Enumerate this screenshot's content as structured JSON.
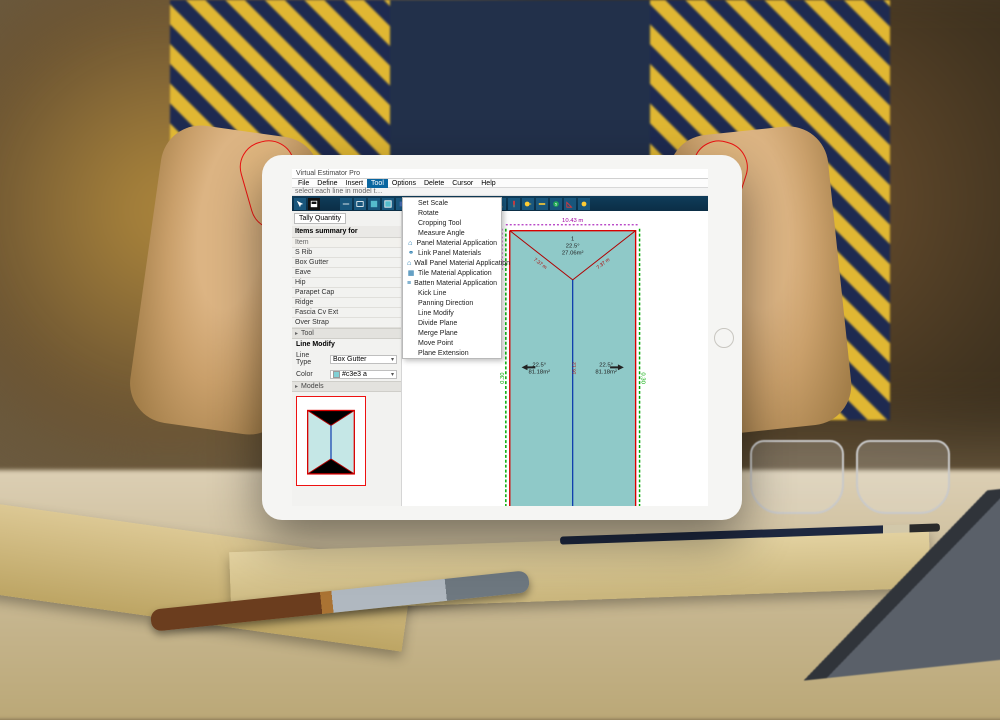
{
  "app_title": "Virtual Estimator Pro",
  "menu": [
    "File",
    "Define",
    "Insert",
    "Tool",
    "Options",
    "Delete",
    "Cursor",
    "Help"
  ],
  "menu_active_index": 3,
  "helper_text": "select each line in model t…",
  "toolbar_icons": [
    "select",
    "save",
    "undo",
    "redo",
    "hline",
    "rect",
    "panel",
    "fill",
    "square1",
    "square2",
    "square3",
    "knife",
    "wrench",
    "gear",
    "paint",
    "hammer",
    "hammer2",
    "tape",
    "ruler",
    "circle5",
    "angle",
    "tape2"
  ],
  "left": {
    "tab_label": "Tally Quantity",
    "items_header": "Items summary for",
    "items_col": "Item",
    "items": [
      "S Rib",
      "Box Gutter",
      "Eave",
      "Hip",
      "Parapet Cap",
      "Ridge",
      "Fascia Cv Ext",
      "Over Strap"
    ],
    "tool_section": "Tool",
    "linemodify_title": "Line Modify",
    "linetype_label": "Line Type",
    "linetype_value": "Box Gutter",
    "color_label": "Color",
    "color_value": "#c3e3 a",
    "models_section": "Models"
  },
  "dropdown": {
    "items": [
      {
        "label": "Set Scale",
        "icon": ""
      },
      {
        "label": "Rotate",
        "icon": ""
      },
      {
        "label": "Cropping Tool",
        "icon": ""
      },
      {
        "label": "Measure Angle",
        "icon": ""
      },
      {
        "label": "Panel Material Application",
        "icon": "home"
      },
      {
        "label": "Link Panel Materials",
        "icon": "link"
      },
      {
        "label": "Wall Panel Material Application",
        "icon": "home"
      },
      {
        "label": "Tile Material Application",
        "icon": "tile"
      },
      {
        "label": "Batten Material Application",
        "icon": "batten"
      },
      {
        "label": "Kick Line",
        "icon": ""
      },
      {
        "label": "Panning Direction",
        "icon": ""
      },
      {
        "label": "Line Modify",
        "icon": ""
      },
      {
        "label": "Divide Plane",
        "icon": ""
      },
      {
        "label": "Merge Plane",
        "icon": ""
      },
      {
        "label": "Move Point",
        "icon": ""
      },
      {
        "label": "Plane Extension",
        "icon": ""
      }
    ]
  },
  "plan": {
    "top_width": "10.43 m",
    "panel_top": {
      "id": "1",
      "angle": "22.5°",
      "area": "27.06m²"
    },
    "panel_side": {
      "angle": "22.5°",
      "area": "81.18m²"
    },
    "arrow_label": "22.5°",
    "hip_left": "7.37 m",
    "hip_right": "7.37 m",
    "side_height": "16.12",
    "left_depth": "0.32",
    "left_depth2": "0.30"
  }
}
